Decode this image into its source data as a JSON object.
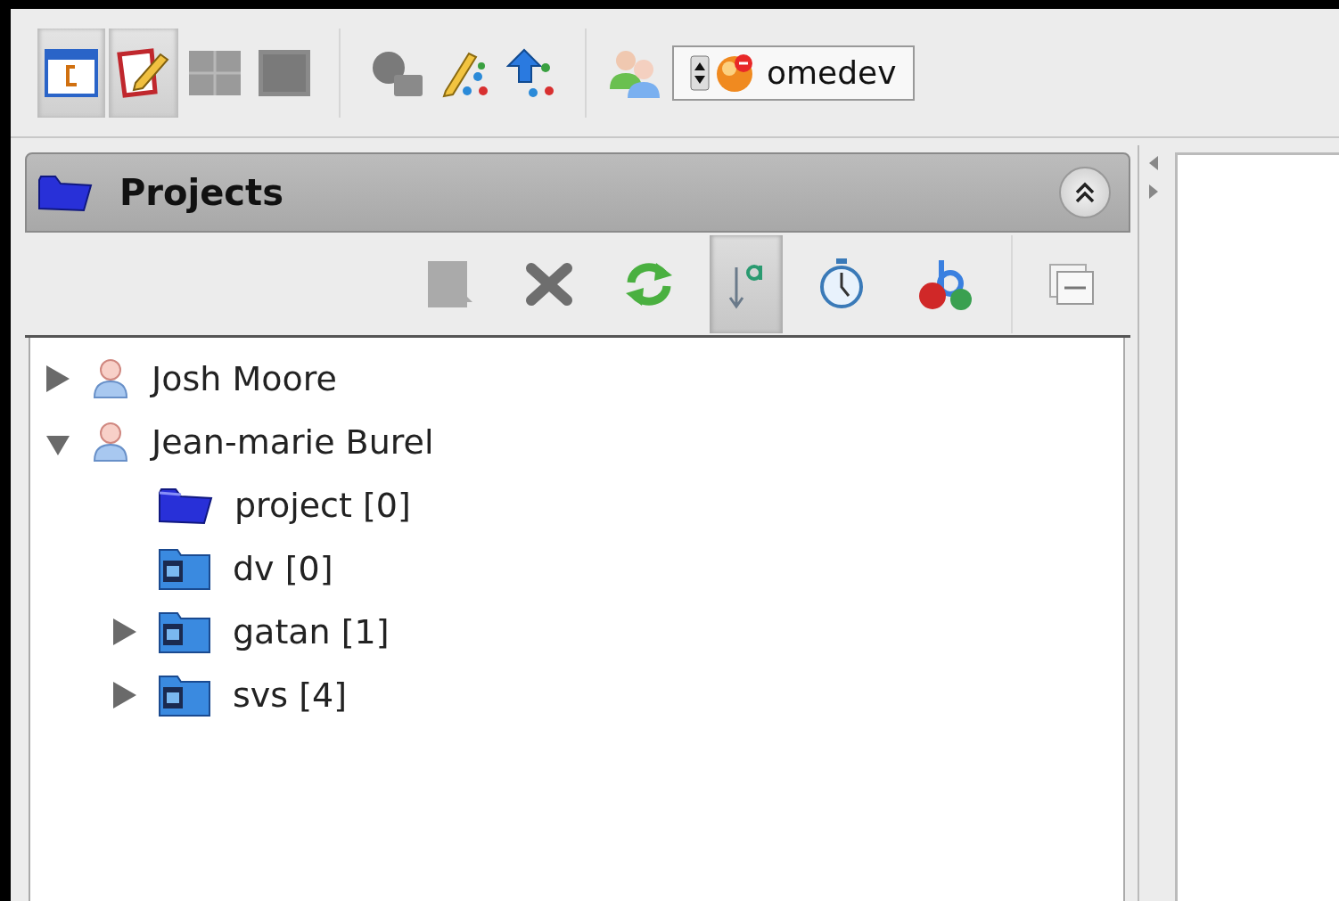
{
  "main_toolbar": [
    {
      "kind": "browser",
      "selected": true
    },
    {
      "kind": "editor",
      "selected": true
    },
    {
      "kind": "grid",
      "selected": false
    },
    {
      "kind": "single",
      "selected": false
    },
    {
      "kind": "search"
    },
    {
      "kind": "annotate"
    },
    {
      "kind": "import"
    }
  ],
  "group_selector": {
    "value": "omedev"
  },
  "panel": {
    "title": "Projects",
    "expanded": true
  },
  "panel_toolbar": [
    {
      "kind": "new",
      "selected": false,
      "disabled": true
    },
    {
      "kind": "delete",
      "selected": false,
      "disabled": false
    },
    {
      "kind": "refresh",
      "selected": false,
      "disabled": false
    },
    {
      "kind": "sort",
      "selected": true,
      "disabled": false
    },
    {
      "kind": "history",
      "selected": false,
      "disabled": false
    },
    {
      "kind": "tags",
      "selected": false,
      "disabled": false
    },
    {
      "kind": "collapse",
      "selected": false,
      "disabled": false
    }
  ],
  "tree": [
    {
      "label": "Josh Moore",
      "kind": "user",
      "expanded": false
    },
    {
      "label": "Jean-marie Burel",
      "kind": "user",
      "expanded": true,
      "children": [
        {
          "label": "project [0]",
          "kind": "project"
        },
        {
          "label": "dv [0]",
          "kind": "folder"
        },
        {
          "label": "gatan [1]",
          "kind": "folder",
          "expanded": false
        },
        {
          "label": "svs [4]",
          "kind": "folder",
          "expanded": false
        }
      ]
    }
  ]
}
